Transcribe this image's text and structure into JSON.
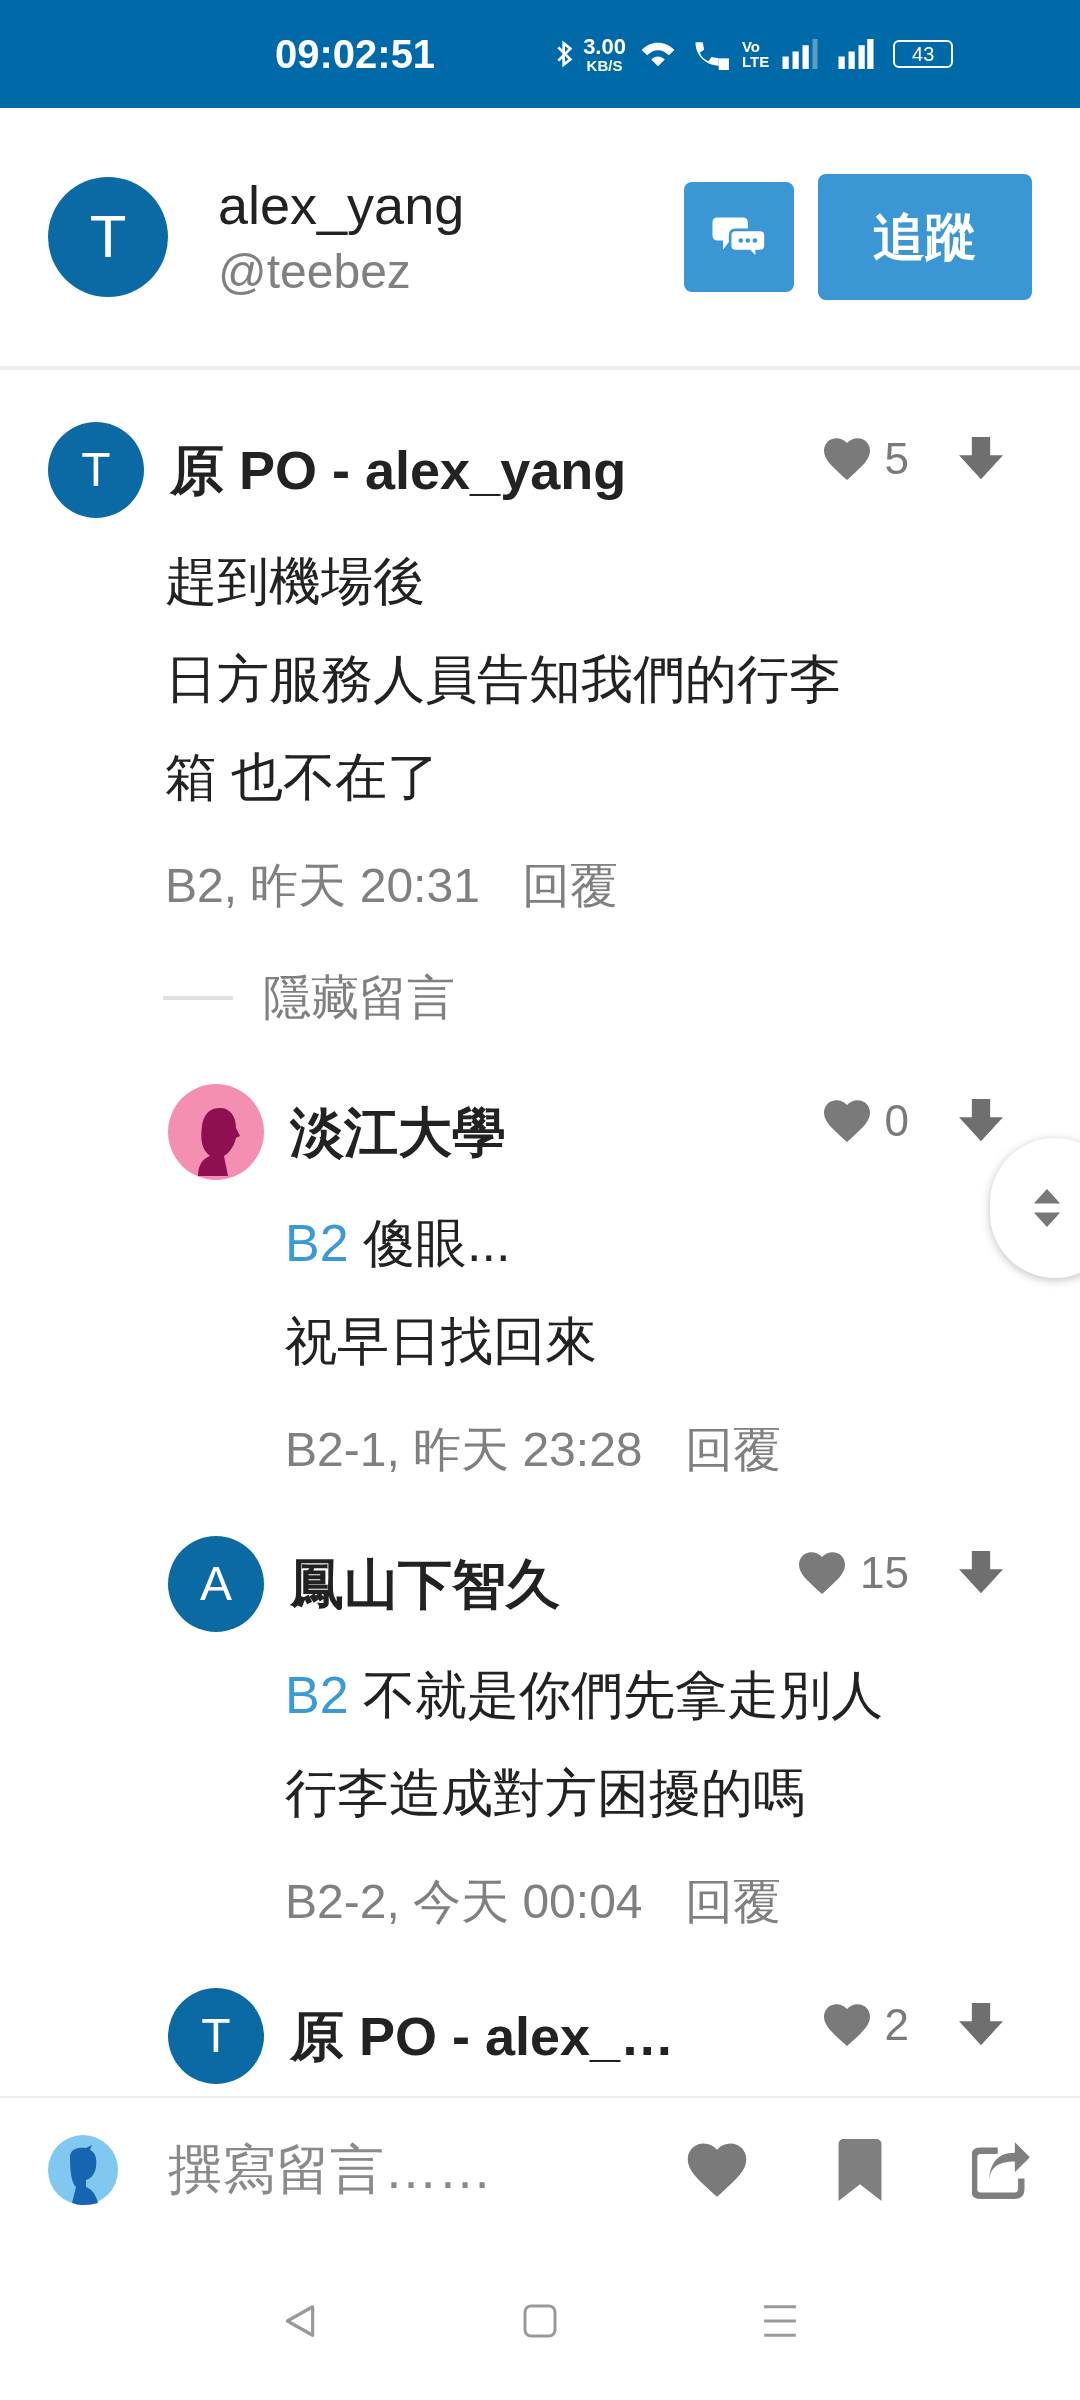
{
  "status_bar": {
    "time": "09:02:51",
    "speed": "3.00",
    "speed_unit": "KB/S",
    "volte": "Vo",
    "lte": "LTE",
    "battery": "43"
  },
  "profile": {
    "avatar_letter": "T",
    "name": "alex_yang",
    "handle": "@teebez",
    "follow_label": "追蹤"
  },
  "comments": [
    {
      "avatar": {
        "kind": "letter",
        "letter": "T"
      },
      "author": "原 PO - alex_yang",
      "likes": "5",
      "body": [
        {
          "text": "趕到機場後"
        },
        {
          "text": "日方服務人員告知我們的行李"
        },
        {
          "text": "箱 也不在了"
        }
      ],
      "meta": "B2, 昨天 20:31",
      "reply_label": "回覆",
      "toggle_label": "隱藏留言",
      "children": [
        {
          "avatar": {
            "kind": "silhouette"
          },
          "author": "淡江大學",
          "likes": "0",
          "body": [
            {
              "mention": "B2",
              "text": "傻眼..."
            },
            {
              "text": "祝早日找回來"
            }
          ],
          "meta": "B2-1, 昨天 23:28",
          "reply_label": "回覆"
        },
        {
          "avatar": {
            "kind": "letter",
            "letter": "A"
          },
          "author": "鳳山下智久",
          "likes": "15",
          "body": [
            {
              "mention": "B2",
              "text": "不就是你們先拿走別人"
            },
            {
              "text": "行李造成對方困擾的嗎"
            }
          ],
          "meta": "B2-2, 今天 00:04",
          "reply_label": "回覆"
        },
        {
          "avatar": {
            "kind": "letter",
            "letter": "T"
          },
          "author": "原 PO - alex_…",
          "likes": "2"
        }
      ]
    }
  ],
  "composer": {
    "placeholder": "撰寫留言……"
  }
}
